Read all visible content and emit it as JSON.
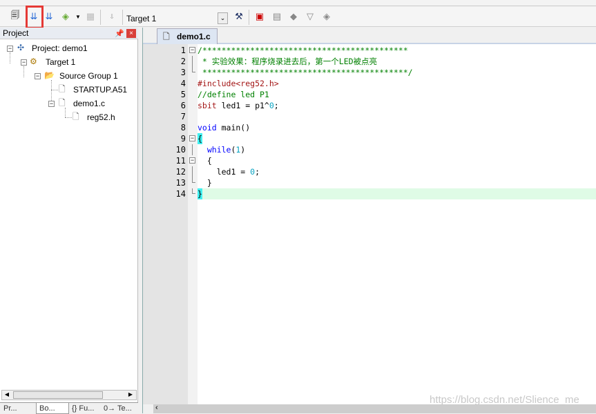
{
  "toolbar": {
    "target_select": "Target 1",
    "icons": [
      "translate-icon",
      "build-icon",
      "rebuild-icon",
      "batch-build-icon",
      "stop-build-icon",
      "download-icon",
      "target-options-icon",
      "manage-components-icon",
      "select-packs-icon",
      "manage-run-env-icon",
      "pack-installer-icon",
      "multi-project-icon"
    ]
  },
  "project_panel": {
    "title": "Project",
    "tree": [
      {
        "label": "Project: demo1"
      },
      {
        "label": "Target 1"
      },
      {
        "label": "Source Group 1"
      },
      {
        "label": "STARTUP.A51"
      },
      {
        "label": "demo1.c"
      },
      {
        "label": "reg52.h"
      }
    ],
    "bottom_tabs": [
      "Pr...",
      "Bo...",
      "{} Fu...",
      "0→ Te..."
    ]
  },
  "editor": {
    "tab": "demo1.c",
    "lines": [
      "/*******************************************",
      " * 实验效果：程序烧录进去后，第一个LED被点亮",
      " *******************************************/",
      "#include<reg52.h>",
      "//define led P1",
      "sbit led1 = p1^0;",
      "",
      "void main()",
      "{",
      "  while(1)",
      "  {",
      "    led1 = 0;",
      "  }",
      "}"
    ]
  },
  "watermark": "https://blog.csdn.net/Slience_me",
  "colors": {
    "comment": "#008000",
    "preprocessor": "#a31515",
    "keyword": "#0000ff",
    "number": "#00a0c0",
    "current_line": "#dffbe6",
    "brace_match": "#40f0f0",
    "highlight_box": "#e53935"
  }
}
